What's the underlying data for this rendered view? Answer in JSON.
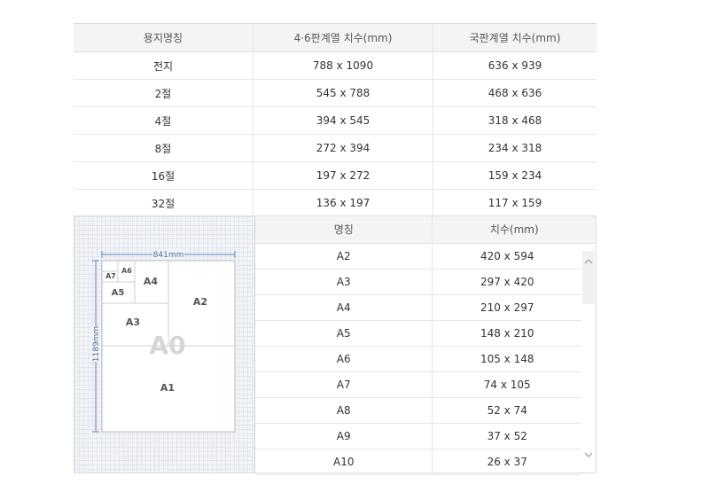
{
  "paper_table": {
    "headers": [
      "용지명칭",
      "4·6판계열 치수(mm)",
      "국판계열 치수(mm)"
    ],
    "rows": [
      [
        "전지",
        "788 x 1090",
        "636 x 939"
      ],
      [
        "2절",
        "545 x 788",
        "468 x 636"
      ],
      [
        "4절",
        "394 x 545",
        "318 x 468"
      ],
      [
        "8절",
        "272 x 394",
        "234 x 318"
      ],
      [
        "16절",
        "197 x 272",
        "159 x 234"
      ],
      [
        "32절",
        "136 x 197",
        "117 x 159"
      ]
    ]
  },
  "diagram": {
    "width_label": "841mm",
    "height_label": "1189mm",
    "labels": {
      "a0": "A0",
      "a1": "A1",
      "a2": "A2",
      "a3": "A3",
      "a4": "A4",
      "a5": "A5",
      "a6": "A6",
      "a7": "A7"
    }
  },
  "a_table": {
    "headers": [
      "명칭",
      "치수(mm)"
    ],
    "rows": [
      [
        "A2",
        "420 x 594"
      ],
      [
        "A3",
        "297 x 420"
      ],
      [
        "A4",
        "210 x 297"
      ],
      [
        "A5",
        "148 x 210"
      ],
      [
        "A6",
        "105 x 148"
      ],
      [
        "A7",
        "74 x 105"
      ],
      [
        "A8",
        "52 x 74"
      ],
      [
        "A9",
        "37 x 52"
      ],
      [
        "A10",
        "26 x 37"
      ]
    ]
  },
  "icons": {
    "scroll_up": "chevron-up-icon",
    "scroll_down": "chevron-down-icon"
  }
}
